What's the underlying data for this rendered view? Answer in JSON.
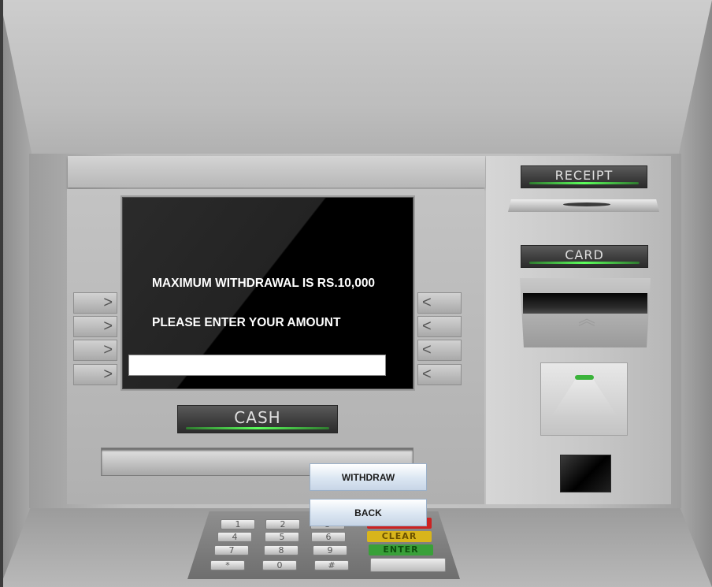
{
  "screen": {
    "line1": "MAXIMUM WITHDRAWAL IS RS.10,000",
    "line2": "PLEASE ENTER YOUR AMOUNT",
    "amount_value": ""
  },
  "labels": {
    "cash": "CASH",
    "receipt": "RECEIPT",
    "card": "CARD"
  },
  "side_buttons": {
    "left_glyph": ">",
    "right_glyph": "<"
  },
  "keypad": {
    "keys": [
      "1",
      "2",
      "3",
      "4",
      "5",
      "6",
      "7",
      "8",
      "9",
      "*",
      "0",
      "#"
    ],
    "clear": "CLEAR",
    "enter": "ENTER"
  },
  "buttons": {
    "withdraw": "WITHDRAW",
    "back": "BACK"
  },
  "colors": {
    "led_green": "#5cff5c",
    "cancel_red": "#cc2222",
    "clear_yellow": "#d8b51b",
    "enter_green": "#39a039"
  }
}
